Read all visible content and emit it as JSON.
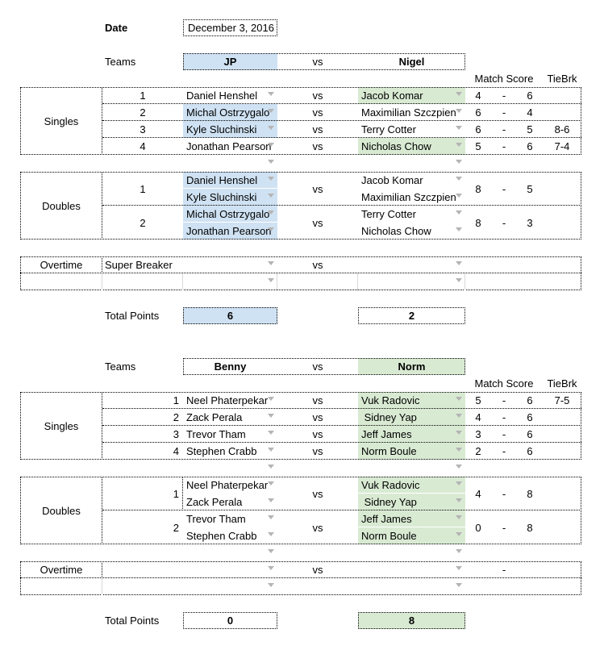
{
  "date": {
    "label": "Date",
    "value": "December 3, 2016"
  },
  "labels": {
    "teams": "Teams",
    "vs": "vs",
    "dash": "-",
    "match_score": "Match Score",
    "tiebreak": "TieBrk",
    "singles": "Singles",
    "doubles": "Doubles",
    "overtime": "Overtime",
    "total_points": "Total Points"
  },
  "highlight_colors": {
    "team1": "#cfe2f3",
    "team2": "#d9ead3"
  },
  "matches": [
    {
      "team1": "JP",
      "team2": "Nigel",
      "winner": "team1",
      "singles": [
        {
          "num": "1",
          "p1": "Daniel Henshel",
          "p2": "Jacob Komar",
          "s1": "4",
          "s2": "6",
          "tiebreak": "",
          "winner": "team2"
        },
        {
          "num": "2",
          "p1": "Michal Ostrzygalo",
          "p2": "Maximilian Szczpien",
          "s1": "6",
          "s2": "4",
          "tiebreak": "",
          "winner": "team1"
        },
        {
          "num": "3",
          "p1": "Kyle Sluchinski",
          "p2": "Terry Cotter",
          "s1": "6",
          "s2": "5",
          "tiebreak": "8-6",
          "winner": "team1"
        },
        {
          "num": "4",
          "p1": "Jonathan Pearson",
          "p2": "Nicholas Chow",
          "s1": "5",
          "s2": "6",
          "tiebreak": "7-4",
          "winner": "team2"
        }
      ],
      "doubles": [
        {
          "num": "1",
          "p1": [
            "Daniel Henshel",
            "Kyle Sluchinski"
          ],
          "p2": [
            "Jacob Komar",
            "Maximilian Szczpien"
          ],
          "s1": "8",
          "s2": "5",
          "winner": "team1"
        },
        {
          "num": "2",
          "p1": [
            "Michal Ostrzygalo",
            "Jonathan Pearson"
          ],
          "p2": [
            "Terry Cotter",
            "Nicholas Chow"
          ],
          "s1": "8",
          "s2": "3",
          "winner": "team1"
        }
      ],
      "overtime": {
        "format": "Super Breaker",
        "dash": ""
      },
      "total": {
        "team1": "6",
        "team2": "2"
      }
    },
    {
      "team1": "Benny",
      "team2": "Norm",
      "winner": "team2",
      "singles": [
        {
          "num": "1",
          "p1": "Neel Phaterpekar",
          "p2": "Vuk Radovic",
          "s1": "5",
          "s2": "6",
          "tiebreak": "7-5",
          "winner": "team2"
        },
        {
          "num": "2",
          "p1": "Zack Perala",
          "p2": " Sidney Yap",
          "s1": "4",
          "s2": "6",
          "tiebreak": "",
          "winner": "team2"
        },
        {
          "num": "3",
          "p1": "Trevor Tham",
          "p2": "Jeff James",
          "s1": "3",
          "s2": "6",
          "tiebreak": "",
          "winner": "team2"
        },
        {
          "num": "4",
          "p1": "Stephen Crabb",
          "p2": "Norm Boule",
          "s1": "2",
          "s2": "6",
          "tiebreak": "",
          "winner": "team2"
        }
      ],
      "doubles": [
        {
          "num": "1",
          "p1": [
            "Neel Phaterpekar",
            "Zack Perala"
          ],
          "p2": [
            "Vuk Radovic",
            " Sidney Yap"
          ],
          "s1": "4",
          "s2": "8",
          "winner": "team2"
        },
        {
          "num": "2",
          "p1": [
            "Trevor Tham",
            "Stephen Crabb"
          ],
          "p2": [
            "Jeff James",
            "Norm Boule"
          ],
          "s1": "0",
          "s2": "8",
          "winner": "team2"
        }
      ],
      "overtime": {
        "format": "",
        "dash": "-"
      },
      "total": {
        "team1": "0",
        "team2": "8"
      }
    }
  ]
}
